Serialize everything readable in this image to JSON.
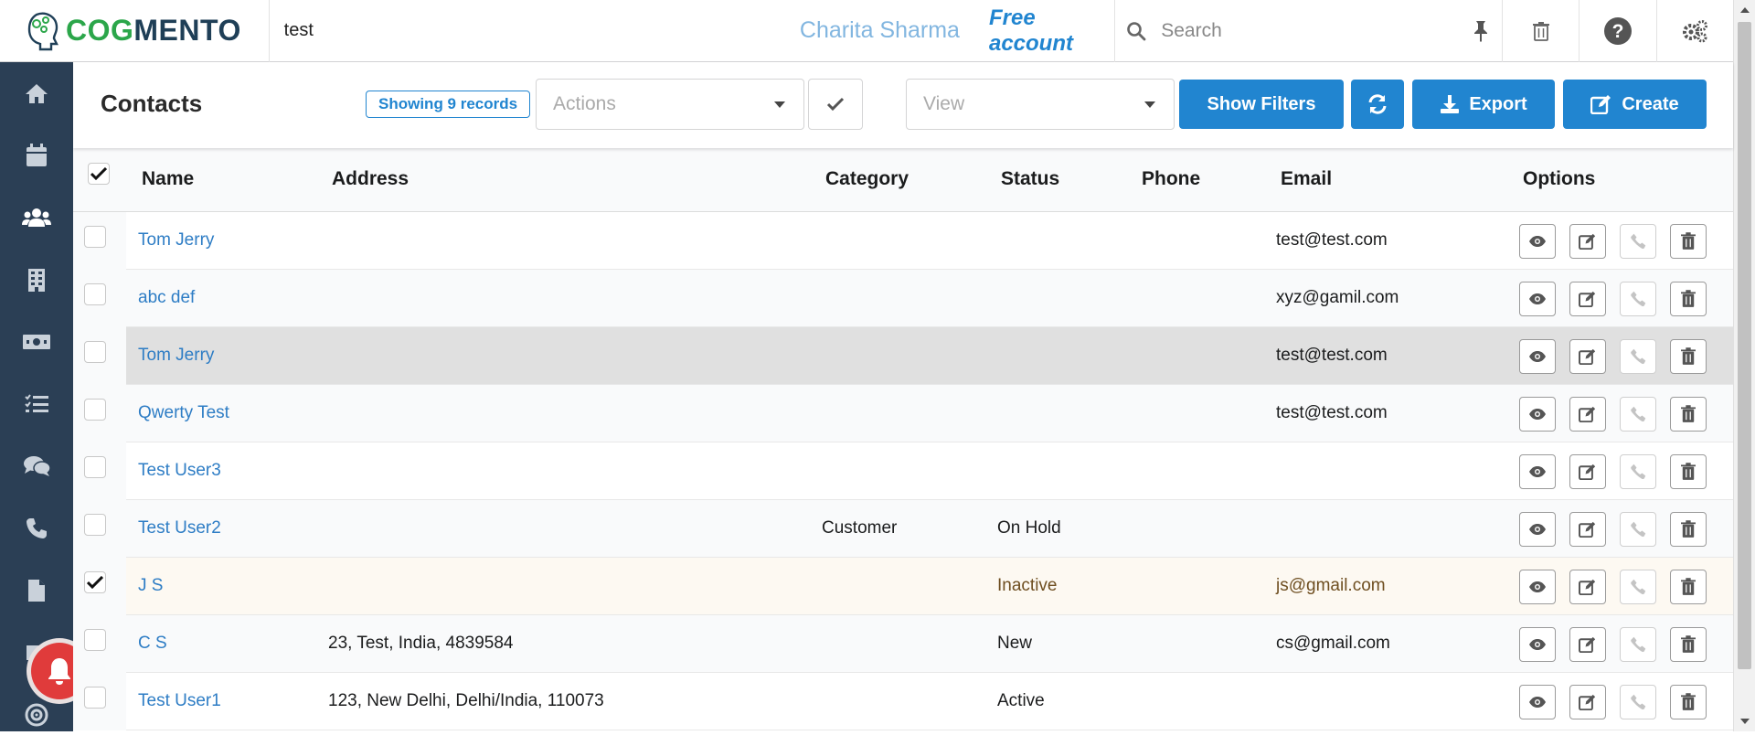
{
  "header": {
    "logo_part1": "COG",
    "logo_part2": "MENTO",
    "search_text": "test",
    "user_name": "Charita Sharma",
    "account_type": "Free account",
    "search_placeholder": "Search"
  },
  "sidebar": {
    "icons": [
      "home-icon",
      "calendar-icon",
      "contacts-icon",
      "companies-icon",
      "deals-icon",
      "tasks-icon",
      "cases-icon",
      "calls-icon",
      "documents-icon",
      "email-icon",
      "campaigns-icon"
    ]
  },
  "toolbar": {
    "title": "Contacts",
    "records_badge": "Showing 9 records",
    "actions_placeholder": "Actions",
    "view_placeholder": "View",
    "show_filters": "Show Filters",
    "export": "Export",
    "create": "Create"
  },
  "table": {
    "columns": [
      "Name",
      "Address",
      "Category",
      "Status",
      "Phone",
      "Email",
      "Options"
    ],
    "rows": [
      {
        "name": "Tom Jerry",
        "address": "",
        "category": "",
        "status": "",
        "phone": "",
        "email": "test@test.com",
        "checked": false
      },
      {
        "name": "abc def",
        "address": "",
        "category": "",
        "status": "",
        "phone": "",
        "email": "xyz@gamil.com",
        "checked": false
      },
      {
        "name": "Tom Jerry",
        "address": "",
        "category": "",
        "status": "",
        "phone": "",
        "email": "test@test.com",
        "checked": false
      },
      {
        "name": "Qwerty Test",
        "address": "",
        "category": "",
        "status": "",
        "phone": "",
        "email": "test@test.com",
        "checked": false
      },
      {
        "name": "Test User3",
        "address": "",
        "category": "",
        "status": "",
        "phone": "",
        "email": "",
        "checked": false
      },
      {
        "name": "Test User2",
        "address": "",
        "category": "Customer",
        "status": "On Hold",
        "phone": "",
        "email": "",
        "checked": false
      },
      {
        "name": "J S",
        "address": "",
        "category": "",
        "status": "Inactive",
        "phone": "",
        "email": "js@gmail.com",
        "checked": true
      },
      {
        "name": "C S",
        "address": "23, Test, India, 4839584",
        "category": "",
        "status": "New",
        "phone": "",
        "email": "cs@gmail.com",
        "checked": false
      },
      {
        "name": "Test User1",
        "address": "123, New Delhi, Delhi/India, 110073",
        "category": "",
        "status": "Active",
        "phone": "",
        "email": "",
        "checked": false
      }
    ]
  },
  "colors": {
    "primary": "#2185d0",
    "sidebar": "#2b3f55",
    "brand_green": "#2ba64a",
    "brand_navy": "#1f3f57",
    "link": "#2e7dc5",
    "notify": "#e03b3b"
  }
}
